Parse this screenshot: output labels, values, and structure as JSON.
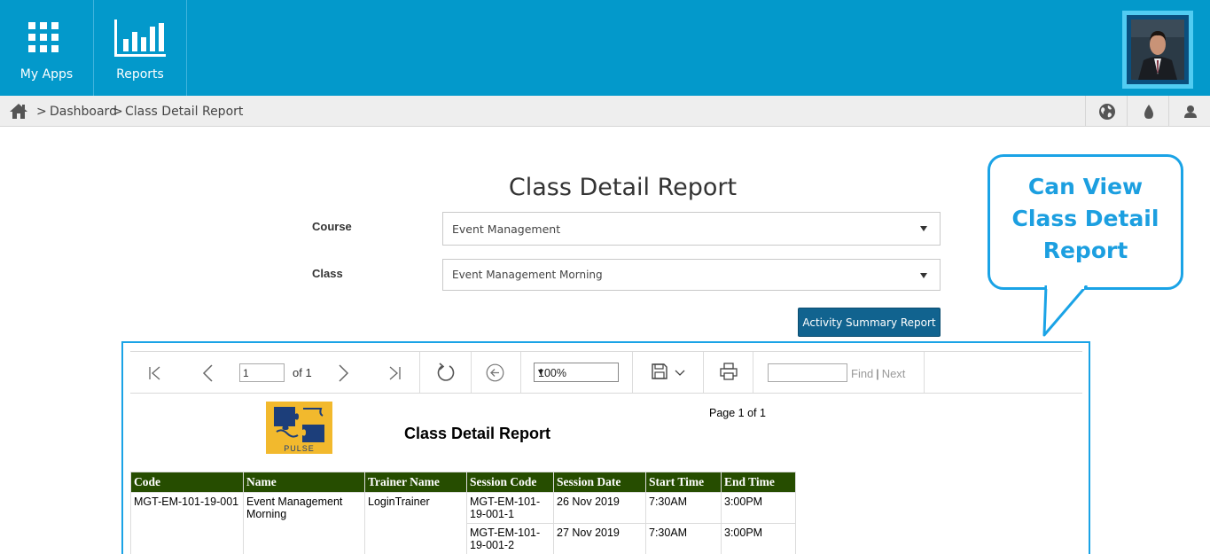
{
  "topbar": {
    "tiles": [
      {
        "label": "My Apps",
        "icon": "apps-grid-icon"
      },
      {
        "label": "Reports",
        "icon": "bar-chart-icon"
      }
    ],
    "accent": "#0399cb"
  },
  "breadcrumb": {
    "separator": ">",
    "items": [
      "Dashboard",
      "Class Detail Report"
    ],
    "right_icons": [
      "globe-icon",
      "droplet-icon",
      "user-icon"
    ]
  },
  "page": {
    "title": "Class Detail Report",
    "course_label": "Course",
    "course_value": "Event Management",
    "class_label": "Class",
    "class_value": "Event Management Morning",
    "activity_button": "Activity Summary Report"
  },
  "callout": {
    "lines": [
      "Can View",
      "Class Detail",
      "Report"
    ],
    "color": "#1aa3e6"
  },
  "viewer": {
    "page_input": "1",
    "of_label": "of 1",
    "zoom": "100%",
    "find_label": "Find",
    "find_sep": "|",
    "next_label": "Next"
  },
  "report": {
    "logo_text": "PULSE",
    "title": "Class Detail Report",
    "page_info": "Page 1 of 1",
    "columns": [
      "Code",
      "Name",
      "Trainer Name",
      "Session Code",
      "Session Date",
      "Start Time",
      "End Time"
    ],
    "rows": [
      {
        "code": "MGT-EM-101-19-001",
        "name": "Event Management Morning",
        "trainer": "LoginTrainer",
        "sessions": [
          {
            "session_code": "MGT-EM-101-19-001-1",
            "date": "26 Nov 2019",
            "start": "7:30AM",
            "end": "3:00PM"
          },
          {
            "session_code": "MGT-EM-101-19-001-2",
            "date": "27 Nov 2019",
            "start": "7:30AM",
            "end": "3:00PM"
          }
        ]
      }
    ],
    "header_color": "#264d00"
  }
}
